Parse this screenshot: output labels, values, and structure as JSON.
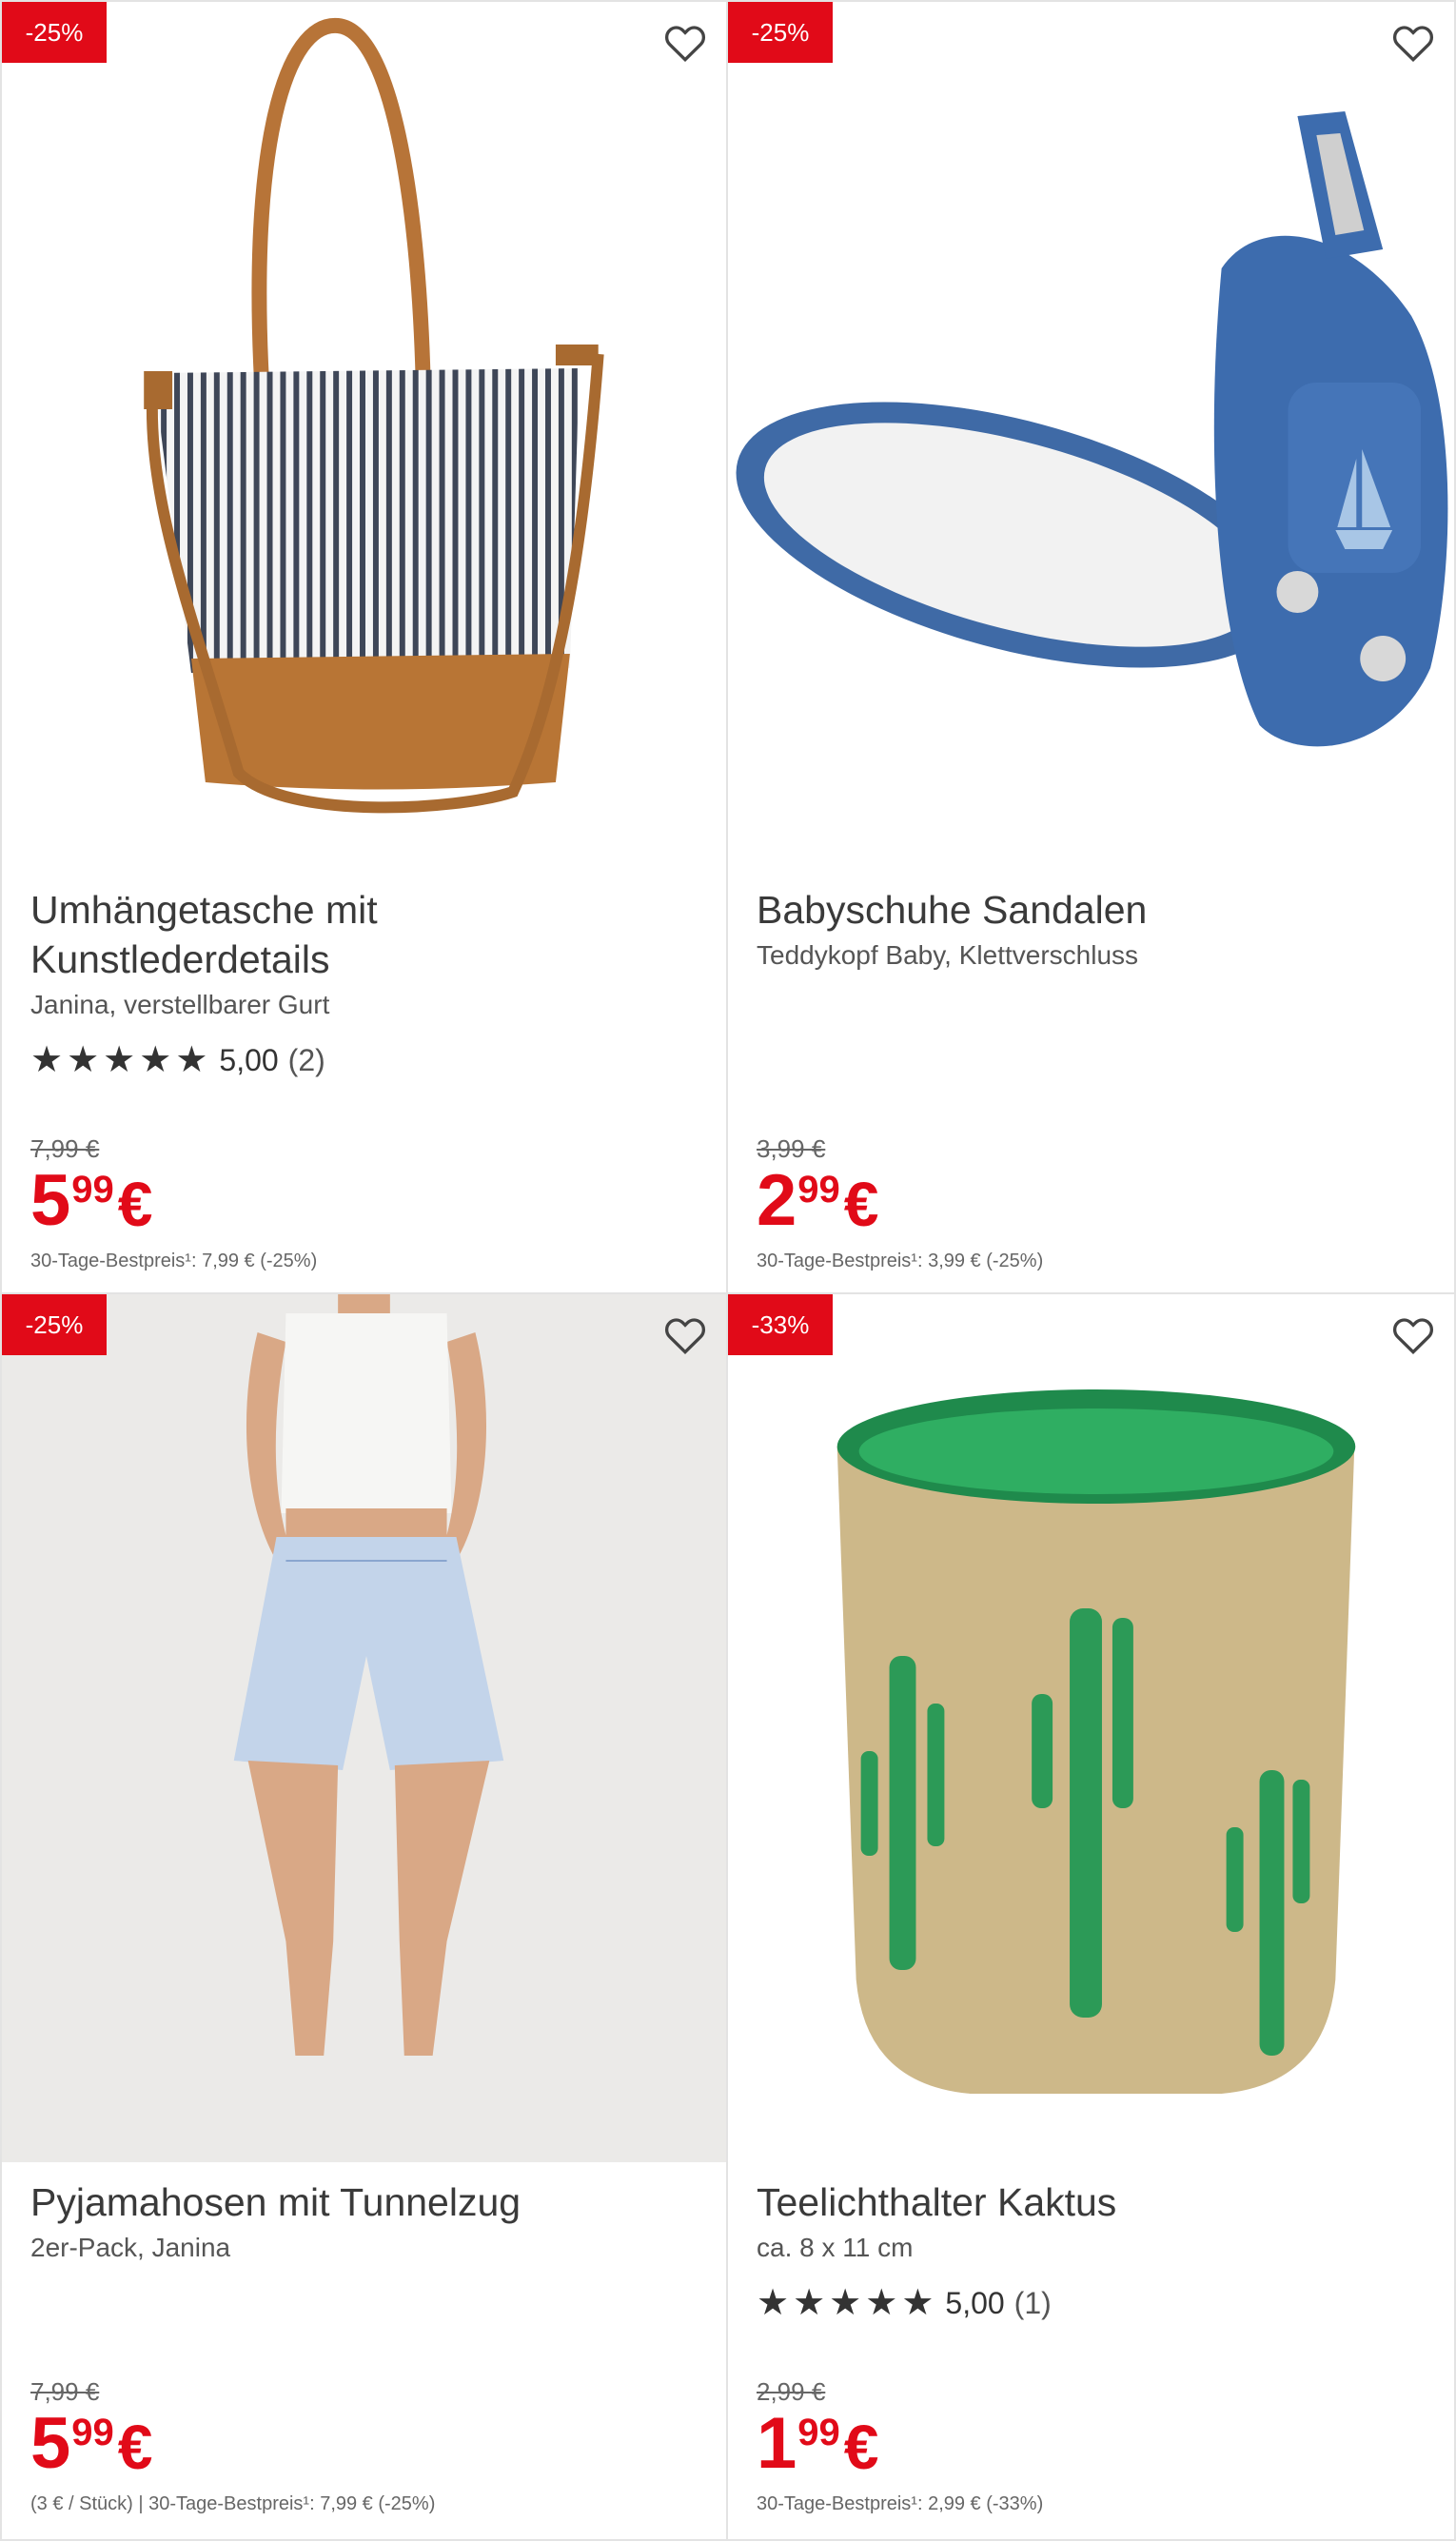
{
  "products": [
    {
      "badge": "-25%",
      "title_line1": "Umhängetasche mit",
      "title_line2": "Kunstlederdetails",
      "subtitle": "Janina, verstellbarer Gurt",
      "rating": {
        "stars": 5,
        "score": "5,00",
        "count": "(2)"
      },
      "old_price": "7,99 €",
      "price_main": "5",
      "price_cents": "99",
      "currency": "€",
      "best_price": "30-Tage-Bestpreis¹: 7,99 € (-25%)",
      "image_icon": "tote-bag-image"
    },
    {
      "badge": "-25%",
      "title_line1": "Babyschuhe Sandalen",
      "title_line2": "",
      "subtitle": "Teddykopf Baby, Klettverschluss",
      "old_price": "3,99 €",
      "price_main": "2",
      "price_cents": "99",
      "currency": "€",
      "best_price": "30-Tage-Bestpreis¹: 3,99 € (-25%)",
      "image_icon": "baby-sandals-image"
    },
    {
      "badge": "-25%",
      "title_line1": "Pyjamahosen mit Tunnelzug",
      "title_line2": "",
      "subtitle": "2er-Pack, Janina",
      "old_price": "7,99 €",
      "price_main": "5",
      "price_cents": "99",
      "currency": "€",
      "best_price": "(3 € / Stück)  |  30-Tage-Bestpreis¹: 7,99 € (-25%)",
      "image_icon": "pyjama-shorts-image"
    },
    {
      "badge": "-33%",
      "title_line1": "Teelichthalter Kaktus",
      "title_line2": "",
      "subtitle": "ca. 8 x 11 cm",
      "rating": {
        "stars": 5,
        "score": "5,00",
        "count": "(1)"
      },
      "old_price": "2,99 €",
      "price_main": "1",
      "price_cents": "99",
      "currency": "€",
      "best_price": "30-Tage-Bestpreis¹: 2,99 € (-33%)",
      "image_icon": "cactus-tealight-image"
    }
  ],
  "colors": {
    "accent": "#e10a18",
    "text": "#333333",
    "border": "#e3e3e3"
  },
  "icons": {
    "favorite": "heart-outline-icon",
    "star": "star-icon"
  }
}
